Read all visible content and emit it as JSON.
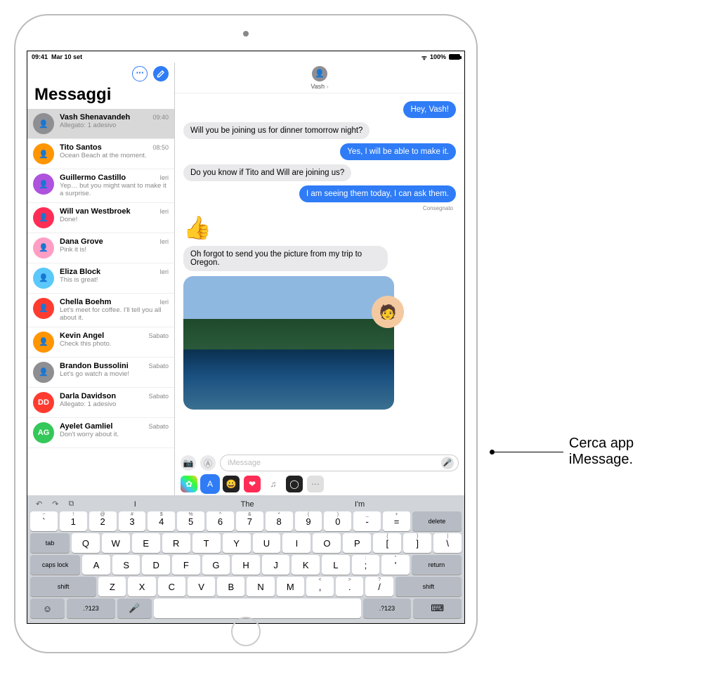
{
  "status": {
    "time": "09:41",
    "date": "Mar 10 set",
    "battery": "100%"
  },
  "sidebar": {
    "title": "Messaggi",
    "items": [
      {
        "name": "Vash Shenavandeh",
        "time": "09:40",
        "preview": "Allegato: 1 adesivo",
        "color": "#8e8e93",
        "selected": true
      },
      {
        "name": "Tito Santos",
        "time": "08:50",
        "preview": "Ocean Beach at the moment.",
        "color": "#ff9500"
      },
      {
        "name": "Guillermo Castillo",
        "time": "Ieri",
        "preview": "Yep… but you might want to make it a surprise.",
        "color": "#af52de"
      },
      {
        "name": "Will van Westbroek",
        "time": "Ieri",
        "preview": "Done!",
        "color": "#ff2d55"
      },
      {
        "name": "Dana Grove",
        "time": "Ieri",
        "preview": "Pink it is!",
        "color": "#ff9ec5"
      },
      {
        "name": "Eliza Block",
        "time": "Ieri",
        "preview": "This is great!",
        "color": "#5ac8fa"
      },
      {
        "name": "Chella Boehm",
        "time": "Ieri",
        "preview": "Let's meet for coffee. I'll tell you all about it.",
        "color": "#ff3b30"
      },
      {
        "name": "Kevin Angel",
        "time": "Sabato",
        "preview": "Check this photo.",
        "color": "#ff9500"
      },
      {
        "name": "Brandon Bussolini",
        "time": "Sabato",
        "preview": "Let's go watch a movie!",
        "color": "#8e8e93"
      },
      {
        "name": "Darla Davidson",
        "time": "Sabato",
        "preview": "Allegato: 1 adesivo",
        "color": "#ff3b30",
        "initials": "DD"
      },
      {
        "name": "Ayelet Gamliel",
        "time": "Sabato",
        "preview": "Don't worry about it.",
        "color": "#34c759",
        "initials": "AG"
      }
    ]
  },
  "chat": {
    "contact": "Vash",
    "messages": [
      {
        "side": "snt",
        "text": "Hey, Vash!"
      },
      {
        "side": "rcv",
        "text": "Will you be joining us for dinner tomorrow night?"
      },
      {
        "side": "snt",
        "text": "Yes, I will be able to make it."
      },
      {
        "side": "rcv",
        "text": "Do you know if Tito and Will are joining us?"
      },
      {
        "side": "snt",
        "text": "I am seeing them today, I can ask them.",
        "delivered": "Consegnato"
      },
      {
        "side": "rcv",
        "emoji": "👍"
      },
      {
        "side": "rcv",
        "text": "Oh forgot to send you the picture from my trip to Oregon."
      },
      {
        "side": "rcv",
        "photo": true
      }
    ],
    "input_placeholder": "iMessage"
  },
  "apps": [
    {
      "name": "photos",
      "color": "linear-gradient(45deg,#f33,#3cf,#3f3,#fc3)",
      "glyph": "✿"
    },
    {
      "name": "store",
      "color": "#2f7cf6",
      "glyph": "A",
      "selected": true
    },
    {
      "name": "memoji",
      "color": "#222",
      "glyph": "😀"
    },
    {
      "name": "digital-touch",
      "color": "#ff2d55",
      "glyph": "❤"
    },
    {
      "name": "music",
      "color": "#fff",
      "glyph": "♫"
    },
    {
      "name": "animoji",
      "color": "#222",
      "glyph": "◯"
    },
    {
      "name": "more",
      "color": "#e0e0e0",
      "glyph": "⋯"
    }
  ],
  "keyboard": {
    "suggestions": [
      "I",
      "The",
      "I'm"
    ],
    "row0": [
      {
        "m": "`",
        "a": "~"
      },
      {
        "m": "1",
        "a": "!"
      },
      {
        "m": "2",
        "a": "@"
      },
      {
        "m": "3",
        "a": "#"
      },
      {
        "m": "4",
        "a": "$"
      },
      {
        "m": "5",
        "a": "%"
      },
      {
        "m": "6",
        "a": "^"
      },
      {
        "m": "7",
        "a": "&"
      },
      {
        "m": "8",
        "a": "*"
      },
      {
        "m": "9",
        "a": "("
      },
      {
        "m": "0",
        "a": ")"
      },
      {
        "m": "-",
        "a": "_"
      },
      {
        "m": "=",
        "a": "+"
      }
    ],
    "delete": "delete",
    "tab": "tab",
    "row1": [
      "Q",
      "W",
      "E",
      "R",
      "T",
      "Y",
      "U",
      "I",
      "O",
      "P"
    ],
    "row1b": [
      {
        "m": "[",
        "a": "{"
      },
      {
        "m": "]",
        "a": "}"
      },
      {
        "m": "\\",
        "a": "|"
      }
    ],
    "caps": "caps lock",
    "row2": [
      "A",
      "S",
      "D",
      "F",
      "G",
      "H",
      "J",
      "K",
      "L"
    ],
    "row2b": [
      {
        "m": ";",
        "a": ":"
      },
      {
        "m": "'",
        "a": "\""
      }
    ],
    "return": "return",
    "shift": "shift",
    "row3": [
      "Z",
      "X",
      "C",
      "V",
      "B",
      "N",
      "M"
    ],
    "row3b": [
      {
        "m": ",",
        "a": "<"
      },
      {
        "m": ".",
        "a": ">"
      },
      {
        "m": "/",
        "a": "?"
      }
    ],
    "numkey": ".?123"
  },
  "callout": "Cerca app iMessage."
}
